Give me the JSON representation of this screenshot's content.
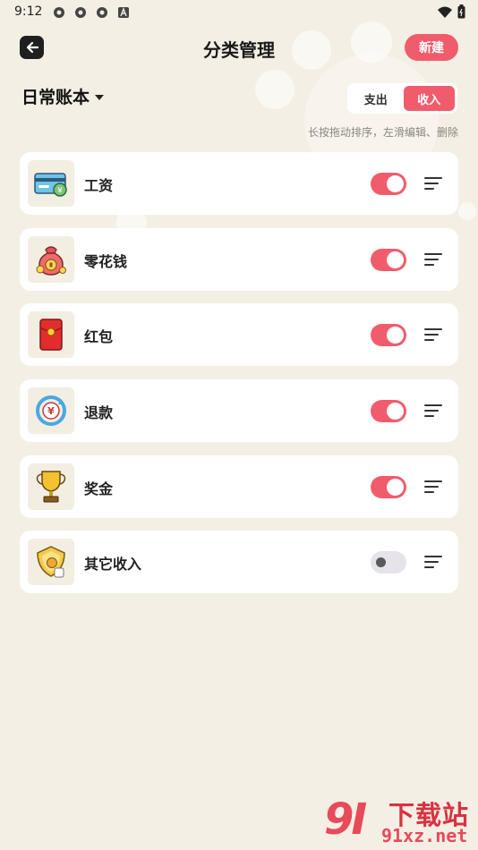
{
  "status_bar": {
    "time": "9:12"
  },
  "header": {
    "title": "分类管理",
    "new_button": "新建"
  },
  "book": {
    "name": "日常账本"
  },
  "segment": {
    "options": [
      "支出",
      "收入"
    ],
    "selected": "收入"
  },
  "hint": "长按拖动排序，左滑编辑、删除",
  "categories": [
    {
      "label": "工资",
      "icon": "salary-card-icon",
      "enabled": true
    },
    {
      "label": "零花钱",
      "icon": "money-bag-icon",
      "enabled": true
    },
    {
      "label": "红包",
      "icon": "red-envelope-icon",
      "enabled": true
    },
    {
      "label": "退款",
      "icon": "refund-icon",
      "enabled": true
    },
    {
      "label": "奖金",
      "icon": "trophy-icon",
      "enabled": true
    },
    {
      "label": "其它收入",
      "icon": "other-income-icon",
      "enabled": false
    }
  ],
  "watermark": {
    "text": "下载站",
    "url": "91xz.net"
  },
  "colors": {
    "accent": "#f05c6c",
    "background": "#f4efe4",
    "card": "#ffffff"
  }
}
